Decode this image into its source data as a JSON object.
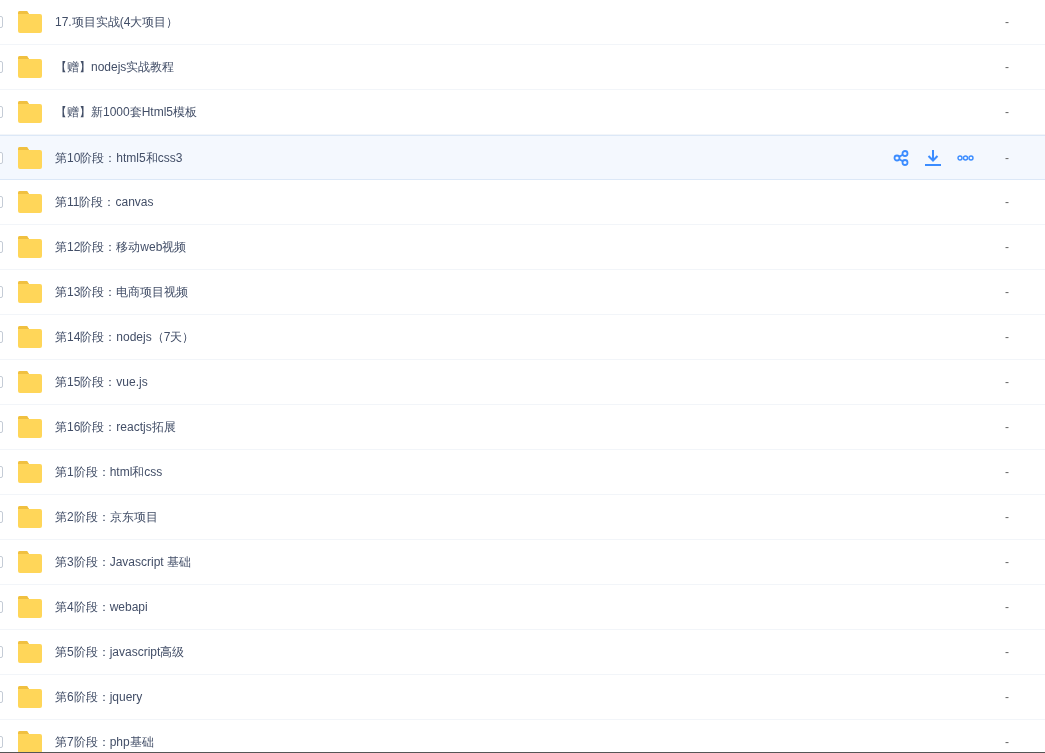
{
  "files": [
    {
      "name": "17.项目实战(4大项目）",
      "size": "-",
      "hovered": false
    },
    {
      "name": "【赠】nodejs实战教程",
      "size": "-",
      "hovered": false
    },
    {
      "name": "【赠】新1000套Html5模板",
      "size": "-",
      "hovered": false
    },
    {
      "name": "第10阶段：html5和css3",
      "size": "-",
      "hovered": true
    },
    {
      "name": "第11阶段：canvas",
      "size": "-",
      "hovered": false
    },
    {
      "name": "第12阶段：移动web视频",
      "size": "-",
      "hovered": false
    },
    {
      "name": "第13阶段：电商项目视频",
      "size": "-",
      "hovered": false
    },
    {
      "name": "第14阶段：nodejs（7天）",
      "size": "-",
      "hovered": false
    },
    {
      "name": "第15阶段：vue.js",
      "size": "-",
      "hovered": false
    },
    {
      "name": "第16阶段：reactjs拓展",
      "size": "-",
      "hovered": false
    },
    {
      "name": "第1阶段：html和css",
      "size": "-",
      "hovered": false
    },
    {
      "name": "第2阶段：京东项目",
      "size": "-",
      "hovered": false
    },
    {
      "name": "第3阶段：Javascript 基础",
      "size": "-",
      "hovered": false
    },
    {
      "name": "第4阶段：webapi",
      "size": "-",
      "hovered": false
    },
    {
      "name": "第5阶段：javascript高级",
      "size": "-",
      "hovered": false
    },
    {
      "name": "第6阶段：jquery",
      "size": "-",
      "hovered": false
    },
    {
      "name": "第7阶段：php基础",
      "size": "-",
      "hovered": false
    }
  ]
}
